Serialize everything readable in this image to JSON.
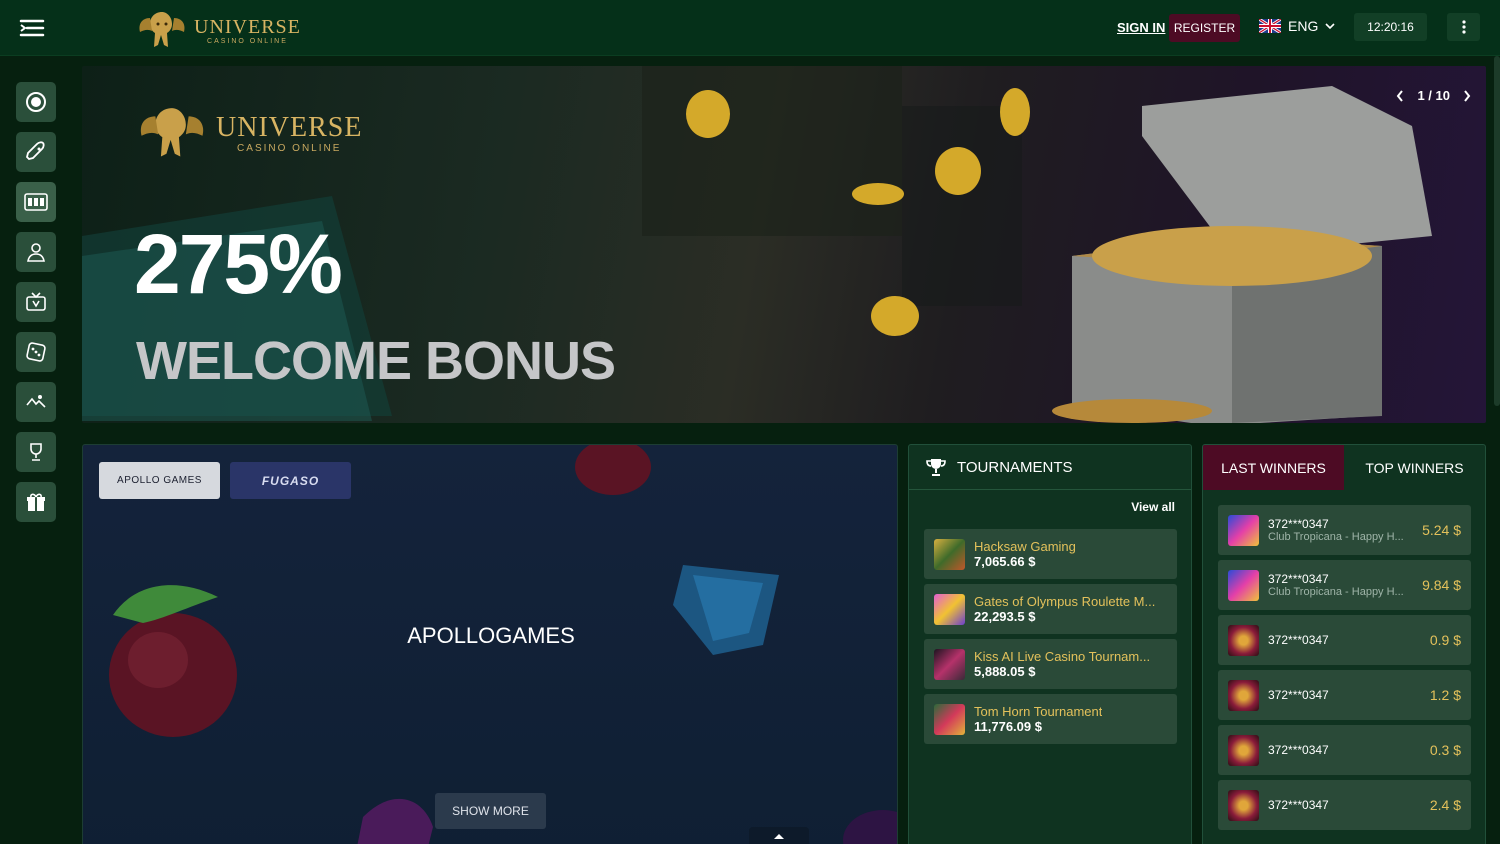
{
  "header": {
    "logo_title": "UNIVERSE",
    "logo_subtitle": "CASINO ONLINE",
    "sign_in_label": "SIGN IN",
    "register_label": "REGISTER",
    "language": "ENG",
    "clock": "12:20:16",
    "accent_color": "#4d0b24"
  },
  "sidebar": {
    "items": [
      {
        "icon": "roulette-icon"
      },
      {
        "icon": "rocket-icon"
      },
      {
        "icon": "slots-icon"
      },
      {
        "icon": "live-dealer-icon"
      },
      {
        "icon": "tv-games-icon"
      },
      {
        "icon": "dice-icon"
      },
      {
        "icon": "virtual-sports-icon"
      },
      {
        "icon": "trophy-icon"
      },
      {
        "icon": "gift-icon"
      }
    ]
  },
  "banner": {
    "logo_title": "UNIVERSE",
    "logo_subtitle": "CASINO ONLINE",
    "headline": "275%",
    "subheadline": "WELCOME BONUS",
    "pager": "1 / 10"
  },
  "providers": {
    "tabs": [
      {
        "label": "APOLLO GAMES"
      },
      {
        "label": "FUGASO"
      }
    ],
    "current_name": "APOLLOGAMES",
    "show_more_label": "SHOW MORE"
  },
  "tournaments": {
    "title": "TOURNAMENTS",
    "view_all_label": "View all",
    "items": [
      {
        "name": "Hacksaw Gaming",
        "amount": "7,065.66 $"
      },
      {
        "name": "Gates of Olympus Roulette M...",
        "amount": "22,293.5 $"
      },
      {
        "name": "Kiss AI Live Casino Tournam...",
        "amount": "5,888.05 $"
      },
      {
        "name": "Tom Horn Tournament",
        "amount": "11,776.09 $"
      }
    ]
  },
  "winners": {
    "tabs": [
      {
        "label": "LAST WINNERS"
      },
      {
        "label": "TOP WINNERS"
      }
    ],
    "items": [
      {
        "user": "372***0347",
        "game": "Club Tropicana - Happy H...",
        "amount": "5.24 $"
      },
      {
        "user": "372***0347",
        "game": "Club Tropicana - Happy H...",
        "amount": "9.84 $"
      },
      {
        "user": "372***0347",
        "game": "",
        "amount": "0.9 $"
      },
      {
        "user": "372***0347",
        "game": "",
        "amount": "1.2 $"
      },
      {
        "user": "372***0347",
        "game": "",
        "amount": "0.3 $"
      },
      {
        "user": "372***0347",
        "game": "",
        "amount": "2.4 $"
      }
    ]
  }
}
